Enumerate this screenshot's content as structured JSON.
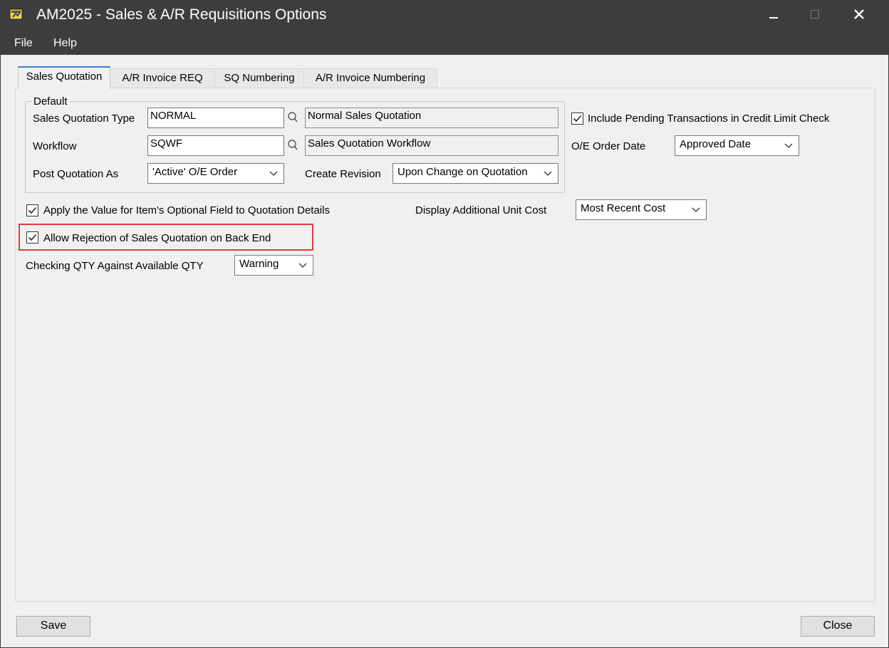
{
  "window": {
    "title": "AM2025 - Sales & A/R Requisitions Options",
    "minimize_symbol": "—",
    "maximize_symbol": "□",
    "close_symbol": "✕"
  },
  "menu": [
    "File",
    "Help"
  ],
  "tabs": [
    "Sales Quotation",
    "A/R Invoice REQ",
    "SQ Numbering",
    "A/R Invoice Numbering"
  ],
  "default_group": {
    "legend": "Default",
    "sales_quotation_type": {
      "label": "Sales Quotation Type",
      "value": "NORMAL",
      "description": "Normal Sales Quotation"
    },
    "workflow": {
      "label": "Workflow",
      "value": "SQWF",
      "description": "Sales Quotation Workflow"
    },
    "post_quotation_as": {
      "label": "Post Quotation As",
      "value": "'Active' O/E Order"
    },
    "create_revision": {
      "label": "Create Revision",
      "value": "Upon Change on Quotation"
    }
  },
  "include_pending": {
    "label": "Include Pending Transactions in Credit Limit Check",
    "checked": true
  },
  "oe_order_date": {
    "label": "O/E Order Date",
    "value": "Approved Date"
  },
  "apply_optional_field": {
    "label": "Apply the Value for Item's Optional Field to Quotation Details",
    "checked": true
  },
  "display_additional_unit_cost": {
    "label": "Display Additional Unit Cost",
    "value": "Most Recent Cost"
  },
  "allow_rejection": {
    "label": "Allow Rejection of Sales Quotation on Back End",
    "checked": true
  },
  "checking_qty": {
    "label": "Checking QTY Against Available QTY",
    "value": "Warning"
  },
  "buttons": {
    "save": "Save",
    "close": "Close"
  },
  "colors": {
    "titlebar": "#3d3d3d",
    "window_bg": "#f0f0f0",
    "active_tab_accent": "#3b7fd0",
    "highlight_border": "#e53b3b"
  }
}
